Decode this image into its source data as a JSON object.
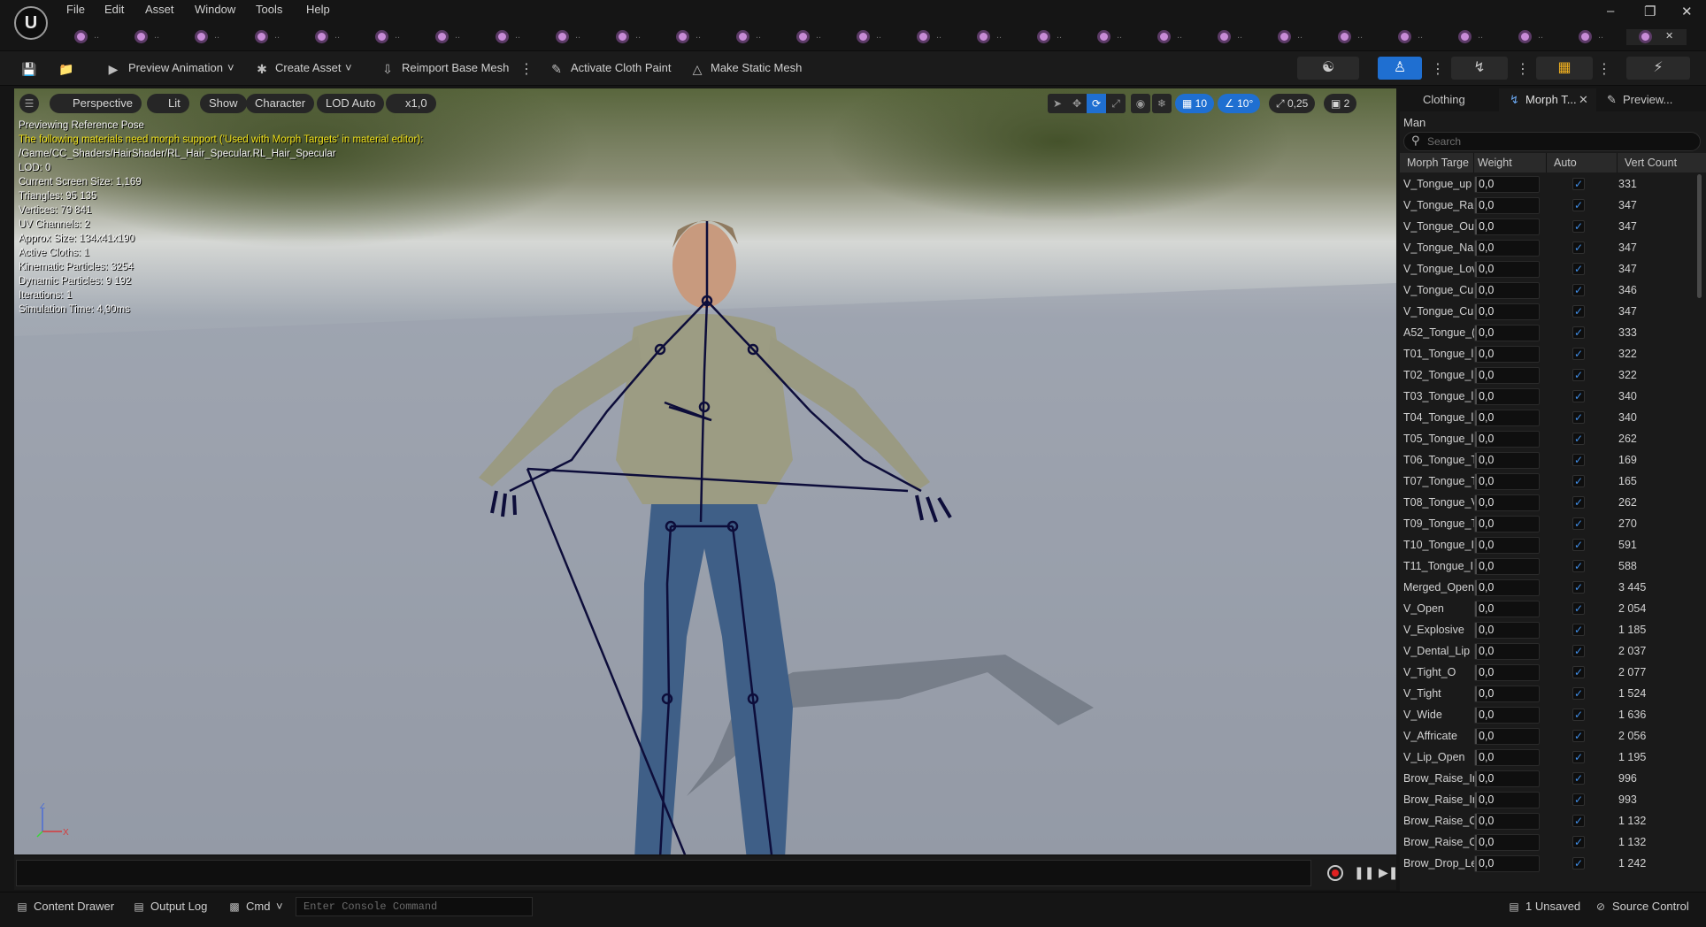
{
  "menu": {
    "items": [
      "File",
      "Edit",
      "Asset",
      "Window",
      "Tools",
      "Help"
    ]
  },
  "doc_tabs": {
    "count": 27,
    "icon": "skeletal-mesh-asset-icon",
    "active_close": "✕"
  },
  "toolbar": {
    "preview_animation": "Preview Animation",
    "create_asset": "Create Asset",
    "reimport": "Reimport Base Mesh",
    "cloth_paint": "Activate Cloth Paint",
    "make_static": "Make Static Mesh"
  },
  "viewport": {
    "perspective": "Perspective",
    "lit": "Lit",
    "show": "Show",
    "character": "Character",
    "lod": "LOD Auto",
    "speed": "x1,0",
    "grid_snap": "10",
    "rot_snap": "10°",
    "scale_snap": "0,25",
    "camera_speed": "2",
    "stats": [
      "Previewing Reference Pose",
      "The following materials need morph support ('Used with Morph Targets' in material editor):",
      "/Game/CC_Shaders/HairShader/RL_Hair_Specular.RL_Hair_Specular",
      "LOD: 0",
      "Current Screen Size: 1,169",
      "Triangles: 95 135",
      "Vertices: 79 841",
      "UV Channels: 2",
      "Approx Size: 134x41x190",
      "Active Cloths: 1",
      "Kinematic Particles: 3254",
      "Dynamic Particles: 9 192",
      "Iterations: 1",
      "Simulation Time: 4,90ms"
    ],
    "axis_z": "Z",
    "axis_x": "X"
  },
  "panel": {
    "tabs": [
      "Clothing",
      "Morph T...",
      "Preview..."
    ],
    "mesh_name": "Man",
    "search_placeholder": "Search",
    "columns": [
      "Morph Targe",
      "Weight",
      "Auto",
      "Vert Count"
    ],
    "rows": [
      {
        "name": "V_Tongue_up",
        "weight": "0,0",
        "count": "331"
      },
      {
        "name": "V_Tongue_Rai",
        "weight": "0,0",
        "count": "347"
      },
      {
        "name": "V_Tongue_Ou",
        "weight": "0,0",
        "count": "347"
      },
      {
        "name": "V_Tongue_Na",
        "weight": "0,0",
        "count": "347"
      },
      {
        "name": "V_Tongue_Lov",
        "weight": "0,0",
        "count": "347"
      },
      {
        "name": "V_Tongue_Cui",
        "weight": "0,0",
        "count": "346"
      },
      {
        "name": "V_Tongue_Cui",
        "weight": "0,0",
        "count": "347"
      },
      {
        "name": "A52_Tongue_(",
        "weight": "0,0",
        "count": "333"
      },
      {
        "name": "T01_Tongue_l",
        "weight": "0,0",
        "count": "322"
      },
      {
        "name": "T02_Tongue_l",
        "weight": "0,0",
        "count": "322"
      },
      {
        "name": "T03_Tongue_l",
        "weight": "0,0",
        "count": "340"
      },
      {
        "name": "T04_Tongue_l",
        "weight": "0,0",
        "count": "340"
      },
      {
        "name": "T05_Tongue_l",
        "weight": "0,0",
        "count": "262"
      },
      {
        "name": "T06_Tongue_T",
        "weight": "0,0",
        "count": "169"
      },
      {
        "name": "T07_Tongue_T",
        "weight": "0,0",
        "count": "165"
      },
      {
        "name": "T08_Tongue_V",
        "weight": "0,0",
        "count": "262"
      },
      {
        "name": "T09_Tongue_T",
        "weight": "0,0",
        "count": "270"
      },
      {
        "name": "T10_Tongue_I",
        "weight": "0,0",
        "count": "591"
      },
      {
        "name": "T11_Tongue_I",
        "weight": "0,0",
        "count": "588"
      },
      {
        "name": "Merged_Open",
        "weight": "0,0",
        "count": "3 445"
      },
      {
        "name": "V_Open",
        "weight": "0,0",
        "count": "2 054"
      },
      {
        "name": "V_Explosive",
        "weight": "0,0",
        "count": "1 185"
      },
      {
        "name": "V_Dental_Lip",
        "weight": "0,0",
        "count": "2 037"
      },
      {
        "name": "V_Tight_O",
        "weight": "0,0",
        "count": "2 077"
      },
      {
        "name": "V_Tight",
        "weight": "0,0",
        "count": "1 524"
      },
      {
        "name": "V_Wide",
        "weight": "0,0",
        "count": "1 636"
      },
      {
        "name": "V_Affricate",
        "weight": "0,0",
        "count": "2 056"
      },
      {
        "name": "V_Lip_Open",
        "weight": "0,0",
        "count": "1 195"
      },
      {
        "name": "Brow_Raise_Ir",
        "weight": "0,0",
        "count": "996"
      },
      {
        "name": "Brow_Raise_Ir",
        "weight": "0,0",
        "count": "993"
      },
      {
        "name": "Brow_Raise_C",
        "weight": "0,0",
        "count": "1 132"
      },
      {
        "name": "Brow_Raise_C",
        "weight": "0,0",
        "count": "1 132"
      },
      {
        "name": "Brow_Drop_Le",
        "weight": "0,0",
        "count": "1 242"
      }
    ]
  },
  "statusbar": {
    "content_drawer": "Content Drawer",
    "output_log": "Output Log",
    "cmd": "Cmd",
    "console_placeholder": "Enter Console Command",
    "unsaved": "1 Unsaved",
    "source_control": "Source Control"
  },
  "colors": {
    "accent": "#1f6fd1",
    "checkbox": "#3f8ee8",
    "warning_text": "#f2e31a",
    "skeleton": "#0d0d3a"
  }
}
